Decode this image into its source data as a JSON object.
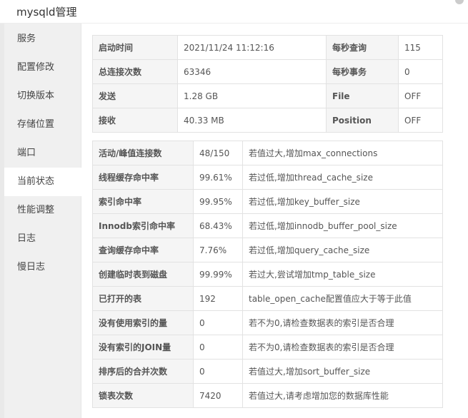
{
  "window": {
    "title": "mysqld管理"
  },
  "sidebar": {
    "items": [
      {
        "label": "服务"
      },
      {
        "label": "配置修改"
      },
      {
        "label": "切换版本"
      },
      {
        "label": "存储位置"
      },
      {
        "label": "端口"
      },
      {
        "label": "当前状态",
        "active": true
      },
      {
        "label": "性能调整"
      },
      {
        "label": "日志"
      },
      {
        "label": "慢日志"
      }
    ]
  },
  "status": [
    {
      "l1": "启动时间",
      "v1": "2021/11/24 11:12:16",
      "l2": "每秒查询",
      "v2": "115"
    },
    {
      "l1": "总连接次数",
      "v1": "63346",
      "l2": "每秒事务",
      "v2": "0"
    },
    {
      "l1": "发送",
      "v1": "1.28 GB",
      "l2": "File",
      "v2": "OFF"
    },
    {
      "l1": "接收",
      "v1": "40.33 MB",
      "l2": "Position",
      "v2": "OFF"
    }
  ],
  "metrics": [
    {
      "name": "活动/峰值连接数",
      "value": "48/150",
      "desc": "若值过大,增加max_connections"
    },
    {
      "name": "线程缓存命中率",
      "value": "99.61%",
      "desc": "若过低,增加thread_cache_size"
    },
    {
      "name": "索引命中率",
      "value": "99.95%",
      "desc": "若过低,增加key_buffer_size"
    },
    {
      "name": "Innodb索引命中率",
      "value": "68.43%",
      "desc": "若过低,增加innodb_buffer_pool_size"
    },
    {
      "name": "查询缓存命中率",
      "value": "7.76%",
      "desc": "若过低,增加query_cache_size"
    },
    {
      "name": "创建临时表到磁盘",
      "value": "99.99%",
      "desc": "若过大,尝试增加tmp_table_size"
    },
    {
      "name": "已打开的表",
      "value": "192",
      "desc": "table_open_cache配置值应大于等于此值"
    },
    {
      "name": "没有使用索引的量",
      "value": "0",
      "desc": "若不为0,请检查数据表的索引是否合理"
    },
    {
      "name": "没有索引的JOIN量",
      "value": "0",
      "desc": "若不为0,请检查数据表的索引是否合理"
    },
    {
      "name": "排序后的合并次数",
      "value": "0",
      "desc": "若值过大,增加sort_buffer_size"
    },
    {
      "name": "锁表次数",
      "value": "7420",
      "desc": "若值过大,请考虑增加您的数据库性能"
    }
  ]
}
